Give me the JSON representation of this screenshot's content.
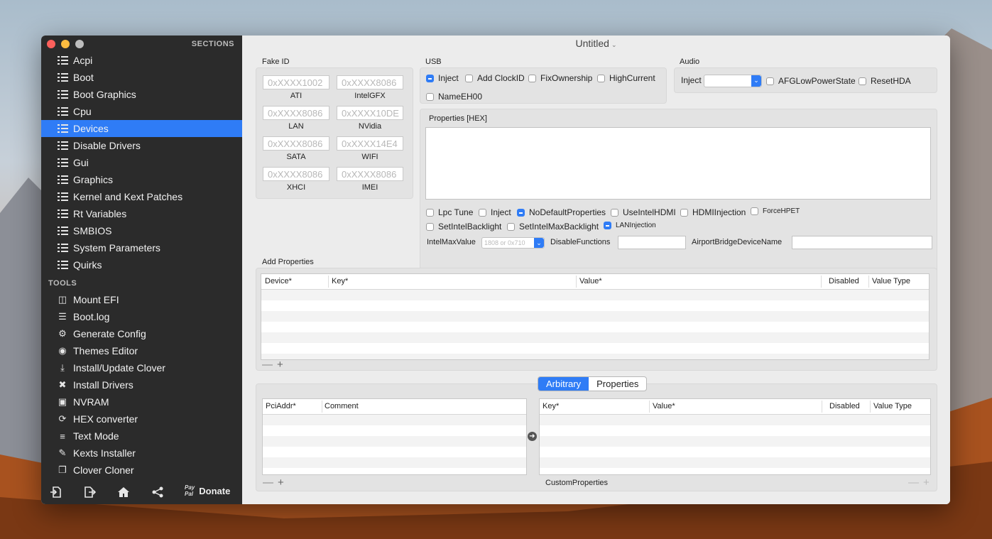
{
  "window": {
    "title": "Untitled"
  },
  "sidebar": {
    "sections_label": "SECTIONS",
    "sections": [
      {
        "label": "Acpi",
        "icon": "list-icon"
      },
      {
        "label": "Boot",
        "icon": "list-icon"
      },
      {
        "label": "Boot Graphics",
        "icon": "list-icon"
      },
      {
        "label": "Cpu",
        "icon": "list-icon"
      },
      {
        "label": "Devices",
        "icon": "list-icon",
        "active": true
      },
      {
        "label": "Disable Drivers",
        "icon": "list-icon"
      },
      {
        "label": "Gui",
        "icon": "list-icon"
      },
      {
        "label": "Graphics",
        "icon": "list-icon"
      },
      {
        "label": "Kernel and Kext Patches",
        "icon": "list-icon"
      },
      {
        "label": "Rt Variables",
        "icon": "list-icon"
      },
      {
        "label": "SMBIOS",
        "icon": "list-icon"
      },
      {
        "label": "System Parameters",
        "icon": "list-icon"
      },
      {
        "label": "Quirks",
        "icon": "list-icon"
      }
    ],
    "tools_label": "TOOLS",
    "tools": [
      {
        "label": "Mount EFI",
        "icon": "disk-icon"
      },
      {
        "label": "Boot.log",
        "icon": "log-search-icon"
      },
      {
        "label": "Generate Config",
        "icon": "gears-icon"
      },
      {
        "label": "Themes Editor",
        "icon": "palette-icon"
      },
      {
        "label": "Install/Update Clover",
        "icon": "download-icon"
      },
      {
        "label": "Install Drivers",
        "icon": "tools-icon"
      },
      {
        "label": "NVRAM",
        "icon": "chip-icon"
      },
      {
        "label": "HEX converter",
        "icon": "refresh-icon"
      },
      {
        "label": "Text Mode",
        "icon": "text-lines-icon"
      },
      {
        "label": "Kexts Installer",
        "icon": "plug-icon"
      },
      {
        "label": "Clover Cloner",
        "icon": "copy-icon"
      }
    ],
    "bottom": {
      "paypal": "Pay\nPal",
      "donate": "Donate"
    }
  },
  "fake_id": {
    "label": "Fake ID",
    "fields": [
      {
        "placeholder": "0xXXXX1002",
        "label": "ATI"
      },
      {
        "placeholder": "0xXXXX8086",
        "label": "IntelGFX"
      },
      {
        "placeholder": "0xXXXX8086",
        "label": "LAN"
      },
      {
        "placeholder": "0xXXXX10DE",
        "label": "NVidia"
      },
      {
        "placeholder": "0xXXXX8086",
        "label": "SATA"
      },
      {
        "placeholder": "0xXXXX14E4",
        "label": "WIFI"
      },
      {
        "placeholder": "0xXXXX8086",
        "label": "XHCI"
      },
      {
        "placeholder": "0xXXXX8086",
        "label": "IMEI"
      }
    ]
  },
  "usb": {
    "label": "USB",
    "inject": "Inject",
    "add_clockid": "Add ClockID",
    "fix_ownership": "FixOwnership",
    "high_current": "HighCurrent",
    "name_eh00": "NameEH00"
  },
  "audio": {
    "label": "Audio",
    "inject_label": "Inject",
    "afg_low_power": "AFGLowPowerState",
    "reset_hda": "ResetHDA"
  },
  "properties": {
    "label": "Properties [HEX]",
    "lpc_tune": "Lpc Tune",
    "inject": "Inject",
    "no_default": "NoDefaultProperties",
    "use_intel_hdmi": "UseIntelHDMI",
    "hdmi_injection": "HDMIInjection",
    "force_hpet": "ForceHPET",
    "set_intel_backlight": "SetIntelBacklight",
    "set_intel_max_backlight": "SetIntelMaxBacklight",
    "lan_injection": "LANInjection",
    "intel_max_value_label": "IntelMaxValue",
    "intel_max_value_placeholder": "1808 or 0x710",
    "disable_functions_label": "DisableFunctions",
    "airport_label": "AirportBridgeDeviceName"
  },
  "add_properties": {
    "label": "Add Properties",
    "columns": [
      "Device*",
      "Key*",
      "Value*",
      "Disabled",
      "Value Type"
    ]
  },
  "custom": {
    "tabs": [
      "Arbitrary",
      "Properties"
    ],
    "left_columns": [
      "PciAddr*",
      "Comment"
    ],
    "right_columns": [
      "Key*",
      "Value*",
      "Disabled",
      "Value Type"
    ],
    "footer_label": "CustomProperties"
  },
  "colors": {
    "accent": "#2f7cf6",
    "sidebar_bg": "#2b2b2b"
  }
}
